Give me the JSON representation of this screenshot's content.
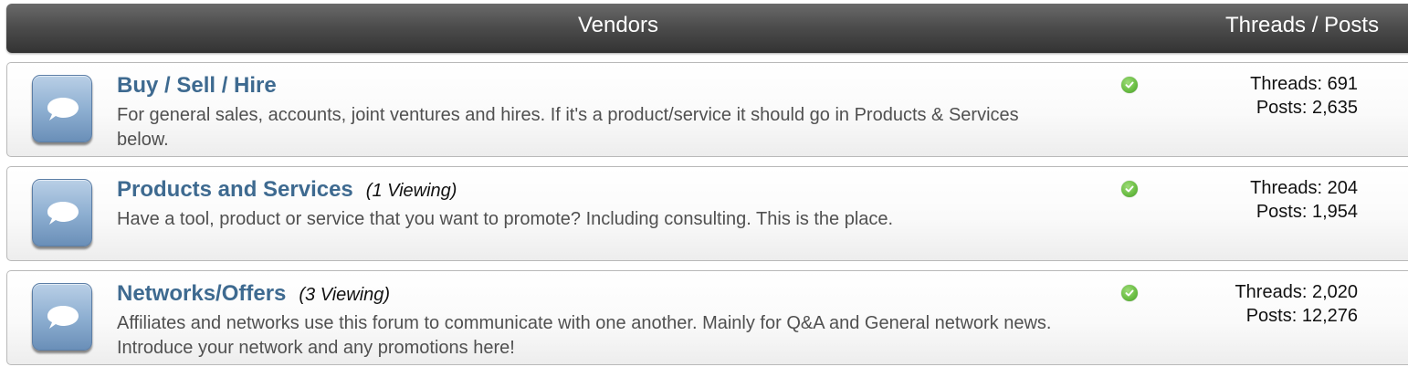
{
  "header": {
    "title": "Vendors",
    "stats_title": "Threads / Posts"
  },
  "forums": [
    {
      "title": "Buy / Sell / Hire",
      "viewing": "",
      "description": "For general sales, accounts, joint ventures and hires. If it's a product/service it should go in Products & Services below.",
      "threads": "Threads: 691",
      "posts": "Posts: 2,635"
    },
    {
      "title": "Products and Services",
      "viewing": "(1 Viewing)",
      "description": "Have a tool, product or service that you want to promote? Including consulting. This is the place.",
      "threads": "Threads: 204",
      "posts": "Posts: 1,954"
    },
    {
      "title": "Networks/Offers",
      "viewing": "(3 Viewing)",
      "description": "Affiliates and networks use this forum to communicate with one another. Mainly for Q&A and General network news. Introduce your network and any promotions here!",
      "threads": "Threads: 2,020",
      "posts": "Posts: 12,276"
    }
  ],
  "icons": {
    "forum_icon": "speech-bubble-icon",
    "status_icon": "checkmark-circle-icon"
  },
  "colors": {
    "header_bg": "#4d4d4d",
    "title_link": "#3e6a90",
    "status_green": "#6cbf45"
  }
}
